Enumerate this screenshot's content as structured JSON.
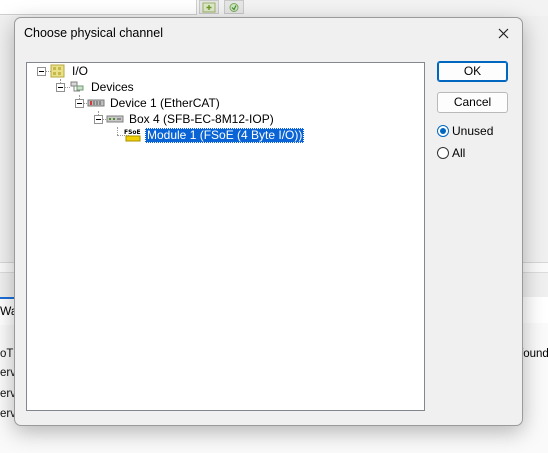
{
  "background": {
    "tab_label": "Wa",
    "log_lines": [
      "oT",
      "erv",
      "erv",
      "erv"
    ],
    "right_text": "found"
  },
  "dialog": {
    "title": "Choose physical channel",
    "ok_label": "OK",
    "cancel_label": "Cancel",
    "options": [
      {
        "label": "Unused",
        "checked": true
      },
      {
        "label": "All",
        "checked": false
      }
    ],
    "tree": [
      {
        "label": "I/O",
        "icon": "io-folder-icon"
      },
      {
        "label": "Devices",
        "icon": "devices-icon"
      },
      {
        "label": "Device 1 (EtherCAT)",
        "icon": "ethercat-device-icon"
      },
      {
        "label": "Box 4 (SFB-EC-8M12-IOP)",
        "icon": "box-module-icon"
      },
      {
        "label": "Module 1 (FSoE (4 Byte I/O))",
        "icon": "fsoe-module-icon",
        "selected": true
      }
    ],
    "fsoe_icon_text": "FSoE"
  },
  "colors": {
    "selection": "#0a64d6",
    "accent": "#0067c0"
  }
}
